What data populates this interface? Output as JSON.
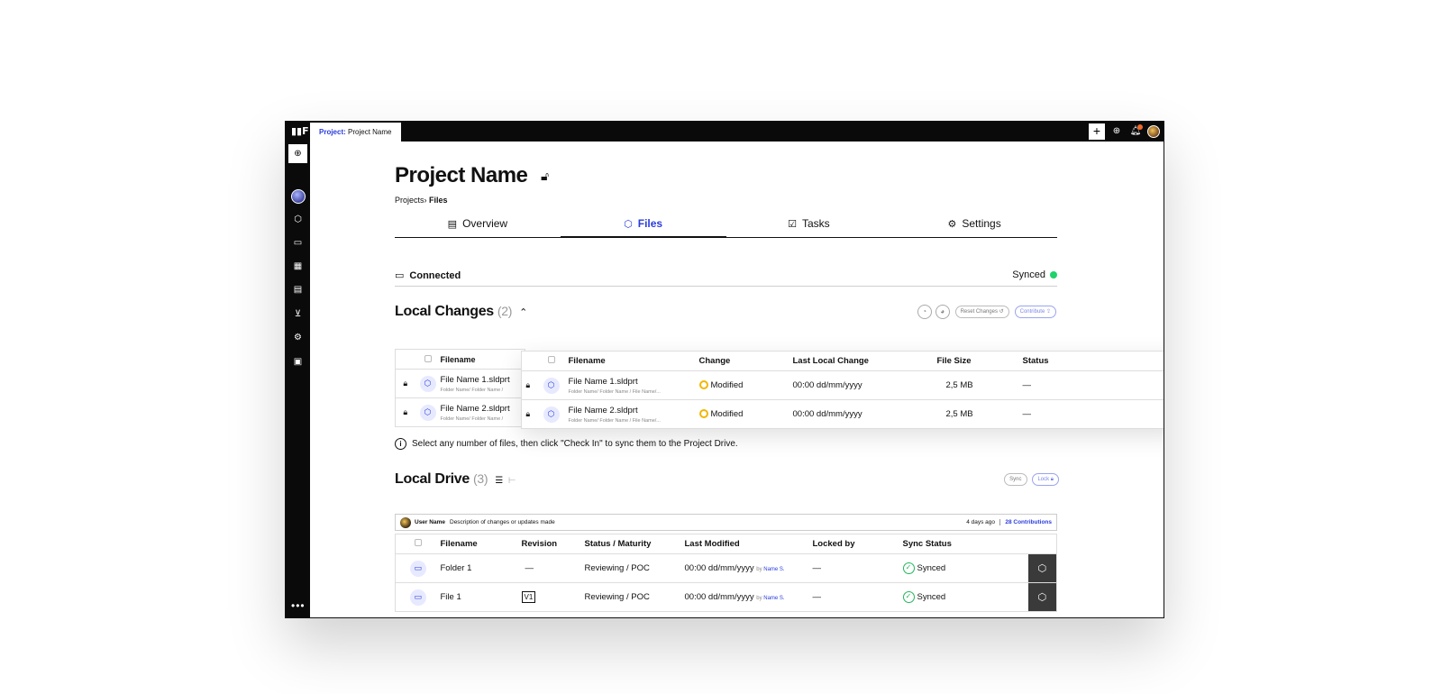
{
  "topbar": {
    "project_key": "Project:",
    "project_name": "Project Name",
    "plus_label": "+"
  },
  "page": {
    "title": "Project Name",
    "breadcrumb": {
      "parent": "Projects",
      "sep": "›",
      "current": "Files"
    }
  },
  "tabs": [
    {
      "label": "Overview",
      "icon": "layout-icon"
    },
    {
      "label": "Files",
      "icon": "cube-icon",
      "active": true
    },
    {
      "label": "Tasks",
      "icon": "checklist-icon"
    },
    {
      "label": "Settings",
      "icon": "gear-icon"
    }
  ],
  "connection": {
    "status": "Connected",
    "sync": "Synced",
    "sync_color": "#1fd26a"
  },
  "local_changes": {
    "title": "Local Changes",
    "count": "(2)",
    "reset_label": "Reset Changes",
    "contribute_label": "Contribute",
    "columns": {
      "filename": "Filename",
      "change": "Change",
      "last_local_change": "Last Local Change",
      "file_size": "File Size",
      "status": "Status"
    },
    "rows": [
      {
        "name": "File Name 1.sldprt",
        "path": "Folder Name/ Folder Name / File Name/...",
        "path_short": "Folder Name/ Folder Name /",
        "change": "Modified",
        "date": "00:00 dd/mm/yyyy",
        "size": "2,5 MB",
        "status": "—"
      },
      {
        "name": "File Name 2.sldprt",
        "path": "Folder Name/ Folder Name / File Name/...",
        "path_short": "Folder Name/ Folder Name /",
        "change": "Modified",
        "date": "00:00 dd/mm/yyyy",
        "size": "2,5 MB",
        "status": "—"
      }
    ],
    "hint": "Select any number of files, then click \"Check In\" to sync them to the Project Drive."
  },
  "local_drive": {
    "title": "Local Drive",
    "count": "(3)",
    "sync_label": "Sync",
    "lock_label": "Lock",
    "commit": {
      "user": "User Name",
      "description": "Description of changes or updates made",
      "ago": "4 days ago",
      "contributions": "28 Contributions"
    },
    "columns": {
      "filename": "Filename",
      "revision": "Revision",
      "status": "Status / Maturity",
      "modified": "Last Modified",
      "locked": "Locked by",
      "sync": "Sync Status"
    },
    "rows": [
      {
        "name": "Folder 1",
        "revision": "—",
        "status": "Reviewing / POC",
        "date": "00:00 dd/mm/yyyy",
        "by": "by",
        "by_name": "Name S.",
        "locked": "—",
        "sync": "Synced"
      },
      {
        "name": "File 1",
        "revision": "V1",
        "status": "Reviewing / POC",
        "date": "00:00 dd/mm/yyyy",
        "by": "by",
        "by_name": "Name S.",
        "locked": "—",
        "sync": "Synced"
      }
    ]
  },
  "colors": {
    "accent": "#2a3cdc",
    "modified": "#f2b600",
    "synced": "#1fb85a"
  }
}
